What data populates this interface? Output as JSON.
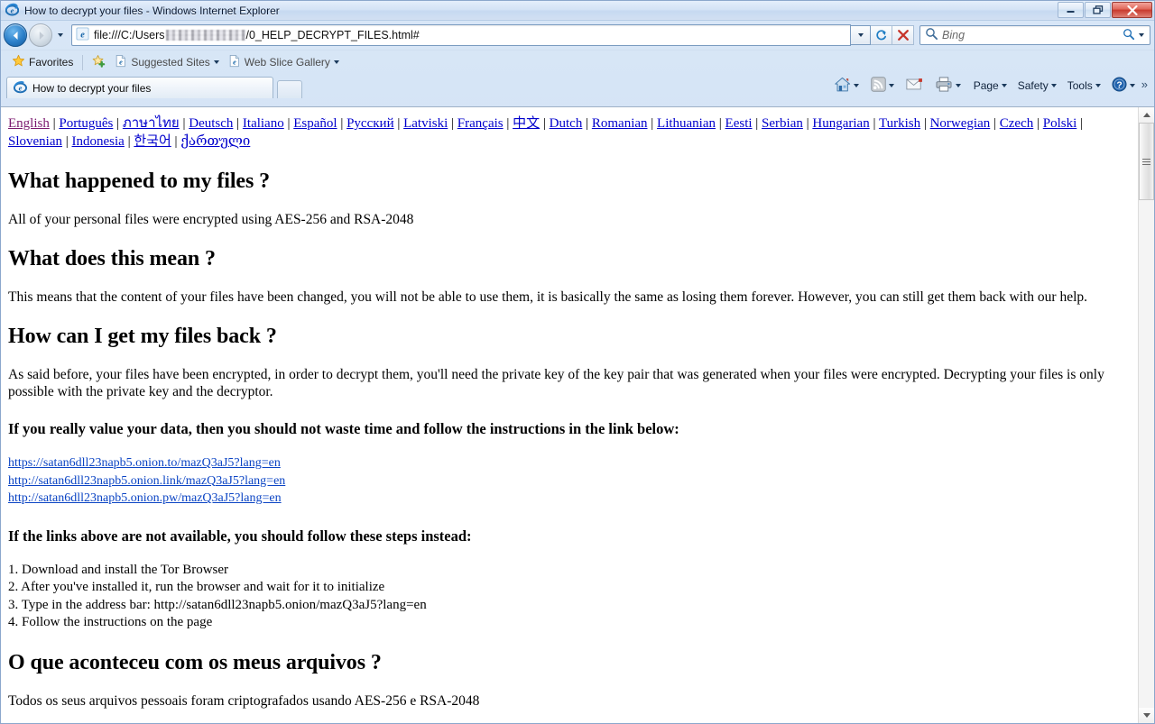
{
  "window": {
    "title": "How to decrypt your files - Windows Internet Explorer",
    "minimize_label": "Minimize",
    "restore_label": "Restore Down",
    "close_label": "Close"
  },
  "navbar": {
    "back_label": "Back",
    "forward_label": "Forward",
    "recent_pages_label": "Recent Pages",
    "url_prefix": "file:///C:/Users",
    "url_suffix": "/0_HELP_DECRYPT_FILES.html#",
    "url_redacted": true,
    "refresh_label": "Refresh",
    "stop_label": "Stop",
    "search_placeholder": "Bing",
    "search_value": ""
  },
  "favorites_bar": {
    "favorites_label": "Favorites",
    "items": [
      {
        "label": "Suggested Sites",
        "icon": "ie-page-icon",
        "has_caret": true
      },
      {
        "label": "Web Slice Gallery",
        "icon": "ie-page-icon",
        "has_caret": true
      }
    ]
  },
  "tabs": {
    "items": [
      {
        "label": "How to decrypt your files",
        "active": true
      }
    ],
    "new_tab_label": "New Tab"
  },
  "command_bar": {
    "items": [
      {
        "name": "home-icon",
        "label": "",
        "has_caret": true
      },
      {
        "name": "feeds-icon",
        "label": "",
        "has_caret": true
      },
      {
        "name": "mail-icon",
        "label": "",
        "has_caret": false
      },
      {
        "name": "print-icon",
        "label": "",
        "has_caret": true
      },
      {
        "name": "page-menu",
        "label": "Page",
        "has_caret": true
      },
      {
        "name": "safety-menu",
        "label": "Safety",
        "has_caret": true
      },
      {
        "name": "tools-menu",
        "label": "Tools",
        "has_caret": true
      },
      {
        "name": "help-menu",
        "label": "",
        "has_caret": true
      }
    ],
    "overflow_label": "»"
  },
  "colors": {
    "link": "#0000cc",
    "link_visited": "#7b1a6f",
    "onion_link": "#0b44c4",
    "page_background": "#ffffff",
    "text": "#000000"
  },
  "page": {
    "languages": [
      {
        "label": "English",
        "visited": true
      },
      {
        "label": "Português",
        "visited": false
      },
      {
        "label": "ภาษาไทย",
        "visited": false
      },
      {
        "label": "Deutsch",
        "visited": false
      },
      {
        "label": "Italiano",
        "visited": false
      },
      {
        "label": "Español",
        "visited": false
      },
      {
        "label": "Русский",
        "visited": false
      },
      {
        "label": "Latviski",
        "visited": false
      },
      {
        "label": "Français",
        "visited": false
      },
      {
        "label": "中文",
        "visited": false
      },
      {
        "label": "Dutch",
        "visited": false
      },
      {
        "label": "Romanian",
        "visited": false
      },
      {
        "label": "Lithuanian",
        "visited": false
      },
      {
        "label": "Eesti",
        "visited": false
      },
      {
        "label": "Serbian",
        "visited": false
      },
      {
        "label": "Hungarian",
        "visited": false
      },
      {
        "label": "Turkish",
        "visited": false
      },
      {
        "label": "Norwegian",
        "visited": false
      },
      {
        "label": "Czech",
        "visited": false
      },
      {
        "label": "Polski",
        "visited": false
      },
      {
        "label": "Slovenian",
        "visited": false
      },
      {
        "label": "Indonesia",
        "visited": false
      },
      {
        "label": "한국어",
        "visited": false
      },
      {
        "label": "ქართული",
        "visited": false
      }
    ],
    "separator": "|",
    "sections": {
      "h1": "What happened to my files ?",
      "p1": "All of your personal files were encrypted using AES-256 and RSA-2048",
      "h2": "What does this mean ?",
      "p2": "This means that the content of your files have been changed, you will not be able to use them, it is basically the same as losing them forever. However, you can still get them back with our help.",
      "h3": "How can I get my files back ?",
      "p3": "As said before, your files have been encrypted, in order to decrypt them, you'll need the private key of the key pair that was generated when your files were encrypted. Decrypting your files is only possible with the private key and the decryptor.",
      "h4": "If you really value your data, then you should not waste time and follow the instructions in the link below:",
      "links": [
        "https://satan6dll23napb5.onion.to/mazQ3aJ5?lang=en",
        "http://satan6dll23napb5.onion.link/mazQ3aJ5?lang=en",
        "http://satan6dll23napb5.onion.pw/mazQ3aJ5?lang=en"
      ],
      "h5": "If the links above are not available, you should follow these steps instead:",
      "steps": [
        "1. Download and install the Tor Browser",
        "2. After you've installed it, run the browser and wait for it to initialize",
        "3. Type in the address bar: http://satan6dll23napb5.onion/mazQ3aJ5?lang=en",
        "4. Follow the instructions on the page"
      ],
      "h6": "O que aconteceu com os meus arquivos ?",
      "p6": "Todos os seus arquivos pessoais foram criptografados usando AES-256 e RSA-2048"
    }
  },
  "scrollbar": {
    "up_label": "Scroll up",
    "down_label": "Scroll down",
    "position_percent": 0
  }
}
